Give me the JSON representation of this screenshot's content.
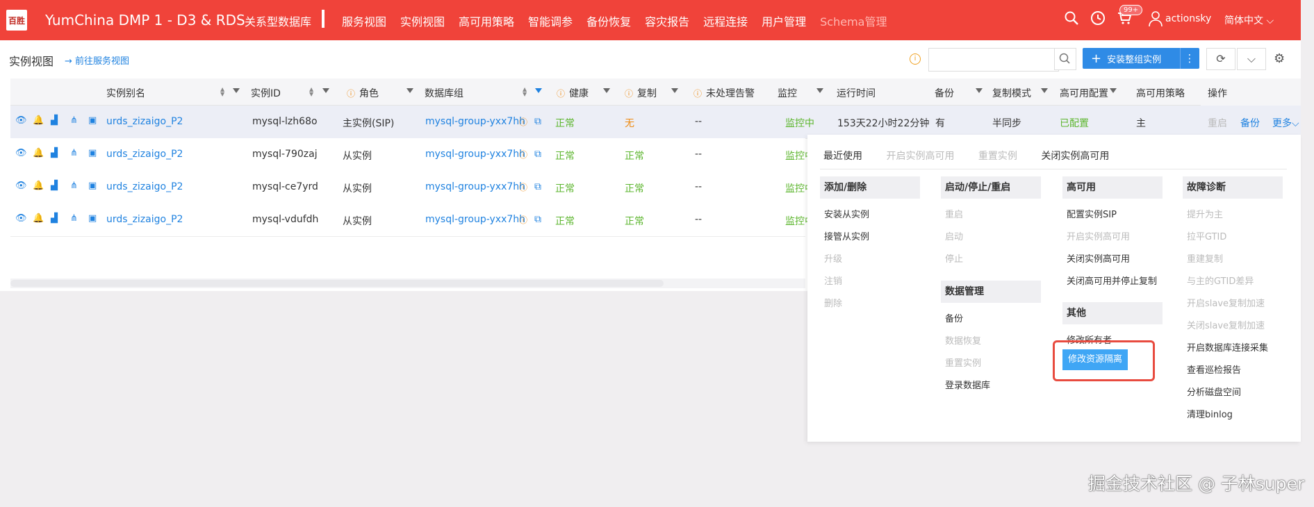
{
  "header": {
    "logo_text": "百胜",
    "app_title": "YumChina DMP 1 - D3 & RDS",
    "primary_nav": "关系型数据库",
    "nav_items": [
      "服务视图",
      "实例视图",
      "高可用策略",
      "智能调参",
      "备份恢复",
      "容灾报告",
      "远程连接",
      "用户管理",
      "Schema管理"
    ],
    "badge": "99+",
    "user": "actionsky",
    "language": "简体中文"
  },
  "page": {
    "title": "实例视图",
    "goto_link": "前往服务视图",
    "search_placeholder": "",
    "install_button": "安装整组实例"
  },
  "table": {
    "columns": [
      "实例别名",
      "实例ID",
      "角色",
      "数据库组",
      "健康",
      "复制",
      "未处理告警",
      "监控",
      "运行时间",
      "备份",
      "复制模式",
      "高可用配置",
      "高可用策略",
      "操作"
    ],
    "rows": [
      {
        "alias": "urds_zizaigo_P2",
        "id": "mysql-lzh68o",
        "role": "主实例(SIP)",
        "group": "mysql-group-yxx7hh",
        "health": "正常",
        "replication": "无",
        "alerts": "--",
        "monitor": "监控中",
        "uptime": "153天22小时22分钟",
        "backup": "有",
        "rep_mode": "半同步",
        "ha_config": "已配置",
        "ha_policy": "主",
        "actions": [
          "重启",
          "备份",
          "更多"
        ]
      },
      {
        "alias": "urds_zizaigo_P2",
        "id": "mysql-790zaj",
        "role": "从实例",
        "group": "mysql-group-yxx7hh",
        "health": "正常",
        "replication": "正常",
        "alerts": "--",
        "monitor": "监控中"
      },
      {
        "alias": "urds_zizaigo_P2",
        "id": "mysql-ce7yrd",
        "role": "从实例",
        "group": "mysql-group-yxx7hh",
        "health": "正常",
        "replication": "正常",
        "alerts": "--",
        "monitor": "监控中"
      },
      {
        "alias": "urds_zizaigo_P2",
        "id": "mysql-vdufdh",
        "role": "从实例",
        "group": "mysql-group-yxx7hh",
        "health": "正常",
        "replication": "正常",
        "alerts": "--",
        "monitor": "监控中"
      }
    ]
  },
  "menu": {
    "recent_label": "最近使用",
    "recent_items": [
      "开启实例高可用",
      "重置实例",
      "关闭实例高可用"
    ],
    "sections": {
      "add_remove": {
        "title": "添加/删除",
        "items": [
          "安装从实例",
          "接管从实例",
          "升级",
          "注销",
          "删除"
        ]
      },
      "start_stop": {
        "title": "启动/停止/重启",
        "items": [
          "重启",
          "启动",
          "停止"
        ]
      },
      "data_mgmt": {
        "title": "数据管理",
        "items": [
          "备份",
          "数据恢复",
          "重置实例",
          "登录数据库"
        ]
      },
      "ha": {
        "title": "高可用",
        "items": [
          "配置实例SIP",
          "开启实例高可用",
          "关闭实例高可用",
          "关闭高可用并停止复制"
        ]
      },
      "other": {
        "title": "其他",
        "items": [
          "修改所有者",
          "修改资源隔离"
        ]
      },
      "diagnosis": {
        "title": "故障诊断",
        "items": [
          "提升为主",
          "拉平GTID",
          "重建复制",
          "与主的GTID差异",
          "开启slave复制加速",
          "关闭slave复制加速",
          "开启数据库连接采集",
          "查看巡检报告",
          "分析磁盘空间",
          "清理binlog"
        ]
      }
    }
  },
  "watermark": "掘金技术社区 @ 子林super",
  "colors": {
    "header": "#f0433a",
    "link": "#1f82e0",
    "ok": "#5bb52c",
    "warn": "#ee8a10",
    "highlight": "#e84b3f"
  }
}
